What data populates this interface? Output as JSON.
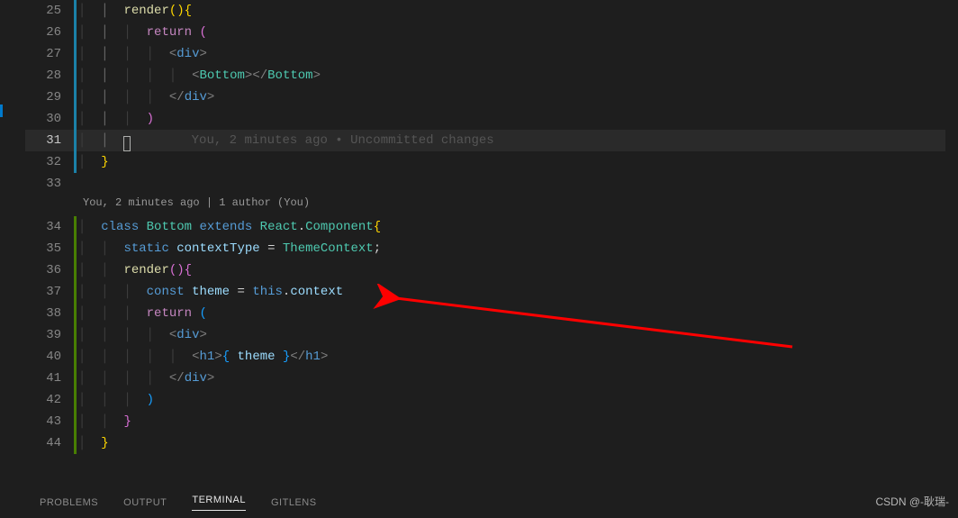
{
  "gitlens_inline": "You, 2 minutes ago • Uncommitted changes",
  "codelens": "You, 2 minutes ago | 1 author (You)",
  "line_numbers": {
    "start": 25,
    "end": 44,
    "highlighted": 31
  },
  "gutter_bars": {
    "blue_range": [
      25,
      32
    ],
    "green_range": [
      34,
      44
    ]
  },
  "code_lines": {
    "l25": {
      "indent": 2,
      "tokens": [
        [
          "render",
          "k-yellow"
        ],
        [
          "()",
          "k-bracket-y"
        ],
        [
          "{",
          "k-bracket-y"
        ]
      ]
    },
    "l26": {
      "indent": 3,
      "tokens": [
        [
          "return ",
          "k-purple"
        ],
        [
          "(",
          "k-bracket-p"
        ]
      ]
    },
    "l27": {
      "indent": 4,
      "tokens": [
        [
          "<",
          "k-tag"
        ],
        [
          "div",
          "k-tagname"
        ],
        [
          ">",
          "k-tag"
        ]
      ]
    },
    "l28": {
      "indent": 5,
      "tokens": [
        [
          "<",
          "k-tag"
        ],
        [
          "Bottom",
          "k-comp"
        ],
        [
          ">",
          "k-tag"
        ],
        [
          "</",
          "k-tag"
        ],
        [
          "Bottom",
          "k-comp"
        ],
        [
          ">",
          "k-tag"
        ]
      ]
    },
    "l29": {
      "indent": 4,
      "tokens": [
        [
          "</",
          "k-tag"
        ],
        [
          "div",
          "k-tagname"
        ],
        [
          ">",
          "k-tag"
        ]
      ]
    },
    "l30": {
      "indent": 3,
      "tokens": [
        [
          ")",
          "k-bracket-p"
        ]
      ]
    },
    "l31": {
      "indent": 2,
      "tokens": [
        [
          "}",
          "k-bracket-y",
          "cursor"
        ]
      ]
    },
    "l32": {
      "indent": 1,
      "tokens": [
        [
          "}",
          "k-bracket-y"
        ]
      ]
    },
    "l33": {
      "indent": 0,
      "tokens": []
    },
    "l34": {
      "indent": 1,
      "tokens": [
        [
          "class ",
          "k-blue"
        ],
        [
          "Bottom ",
          "k-type"
        ],
        [
          "extends ",
          "k-blue"
        ],
        [
          "React",
          "k-type"
        ],
        [
          ".",
          "k-white"
        ],
        [
          "Component",
          "k-type"
        ],
        [
          "{",
          "k-bracket-y"
        ]
      ]
    },
    "l35": {
      "indent": 2,
      "tokens": [
        [
          "static ",
          "k-blue"
        ],
        [
          "contextType",
          "k-var"
        ],
        [
          " = ",
          "k-white"
        ],
        [
          "ThemeContext",
          "k-type"
        ],
        [
          ";",
          "k-white"
        ]
      ]
    },
    "l36": {
      "indent": 2,
      "tokens": [
        [
          "render",
          "k-yellow"
        ],
        [
          "()",
          "k-bracket-p"
        ],
        [
          "{",
          "k-bracket-p"
        ]
      ]
    },
    "l37": {
      "indent": 3,
      "tokens": [
        [
          "const ",
          "k-blue"
        ],
        [
          "theme",
          "k-var"
        ],
        [
          " = ",
          "k-white"
        ],
        [
          "this",
          "k-blue"
        ],
        [
          ".",
          "k-white"
        ],
        [
          "context",
          "k-var"
        ]
      ]
    },
    "l38": {
      "indent": 3,
      "tokens": [
        [
          "return ",
          "k-purple"
        ],
        [
          "(",
          "k-bracket-b"
        ]
      ]
    },
    "l39": {
      "indent": 4,
      "tokens": [
        [
          "<",
          "k-tag"
        ],
        [
          "div",
          "k-tagname"
        ],
        [
          ">",
          "k-tag"
        ]
      ]
    },
    "l40": {
      "indent": 5,
      "tokens": [
        [
          "<",
          "k-tag"
        ],
        [
          "h1",
          "k-tagname"
        ],
        [
          ">",
          "k-tag"
        ],
        [
          "{",
          "k-bracket-b"
        ],
        [
          " theme ",
          "k-var"
        ],
        [
          "}",
          "k-bracket-b"
        ],
        [
          "</",
          "k-tag"
        ],
        [
          "h1",
          "k-tagname"
        ],
        [
          ">",
          "k-tag"
        ]
      ]
    },
    "l41": {
      "indent": 4,
      "tokens": [
        [
          "</",
          "k-tag"
        ],
        [
          "div",
          "k-tagname"
        ],
        [
          ">",
          "k-tag"
        ]
      ]
    },
    "l42": {
      "indent": 3,
      "tokens": [
        [
          ")",
          "k-bracket-b"
        ]
      ]
    },
    "l43": {
      "indent": 2,
      "tokens": [
        [
          "}",
          "k-bracket-p"
        ]
      ]
    },
    "l44": {
      "indent": 1,
      "tokens": [
        [
          "}",
          "k-bracket-y"
        ]
      ]
    }
  },
  "panel": {
    "tabs": [
      "PROBLEMS",
      "OUTPUT",
      "TERMINAL",
      "GITLENS"
    ],
    "active": "TERMINAL"
  },
  "watermark": "CSDN @-耿瑞-",
  "arrow": {
    "color": "#ff0000"
  }
}
